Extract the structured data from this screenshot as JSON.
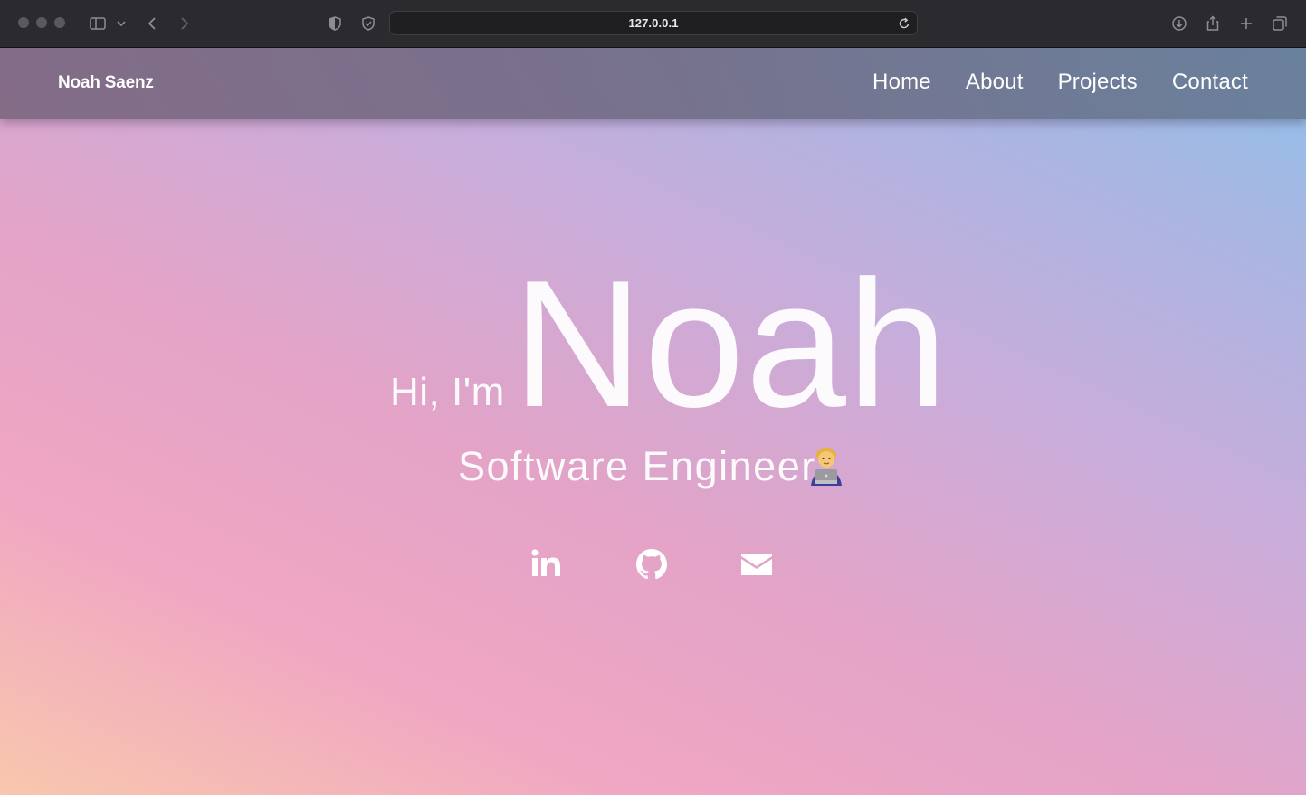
{
  "browser": {
    "url": "127.0.0.1",
    "icons": [
      "sidebar-icon",
      "chevron-down-icon",
      "back-icon",
      "forward-icon",
      "shield-half-icon",
      "shield-check-icon",
      "reload-icon",
      "download-icon",
      "share-icon",
      "new-tab-icon",
      "tabs-overview-icon"
    ]
  },
  "navbar": {
    "brand": "Noah Saenz",
    "links": [
      "Home",
      "About",
      "Projects",
      "Contact"
    ]
  },
  "hero": {
    "greeting": "Hi, I'm",
    "name": "Noah",
    "subtitle": "Software Engineer",
    "emoji": "technologist-emoji",
    "socials": [
      "linkedin-icon",
      "github-icon",
      "email-icon"
    ]
  },
  "colors": {
    "gradient_start": "#f8c7ad",
    "gradient_mid": "#e3a3c7",
    "gradient_end": "#8dc1ea",
    "text": "#ffffff"
  }
}
